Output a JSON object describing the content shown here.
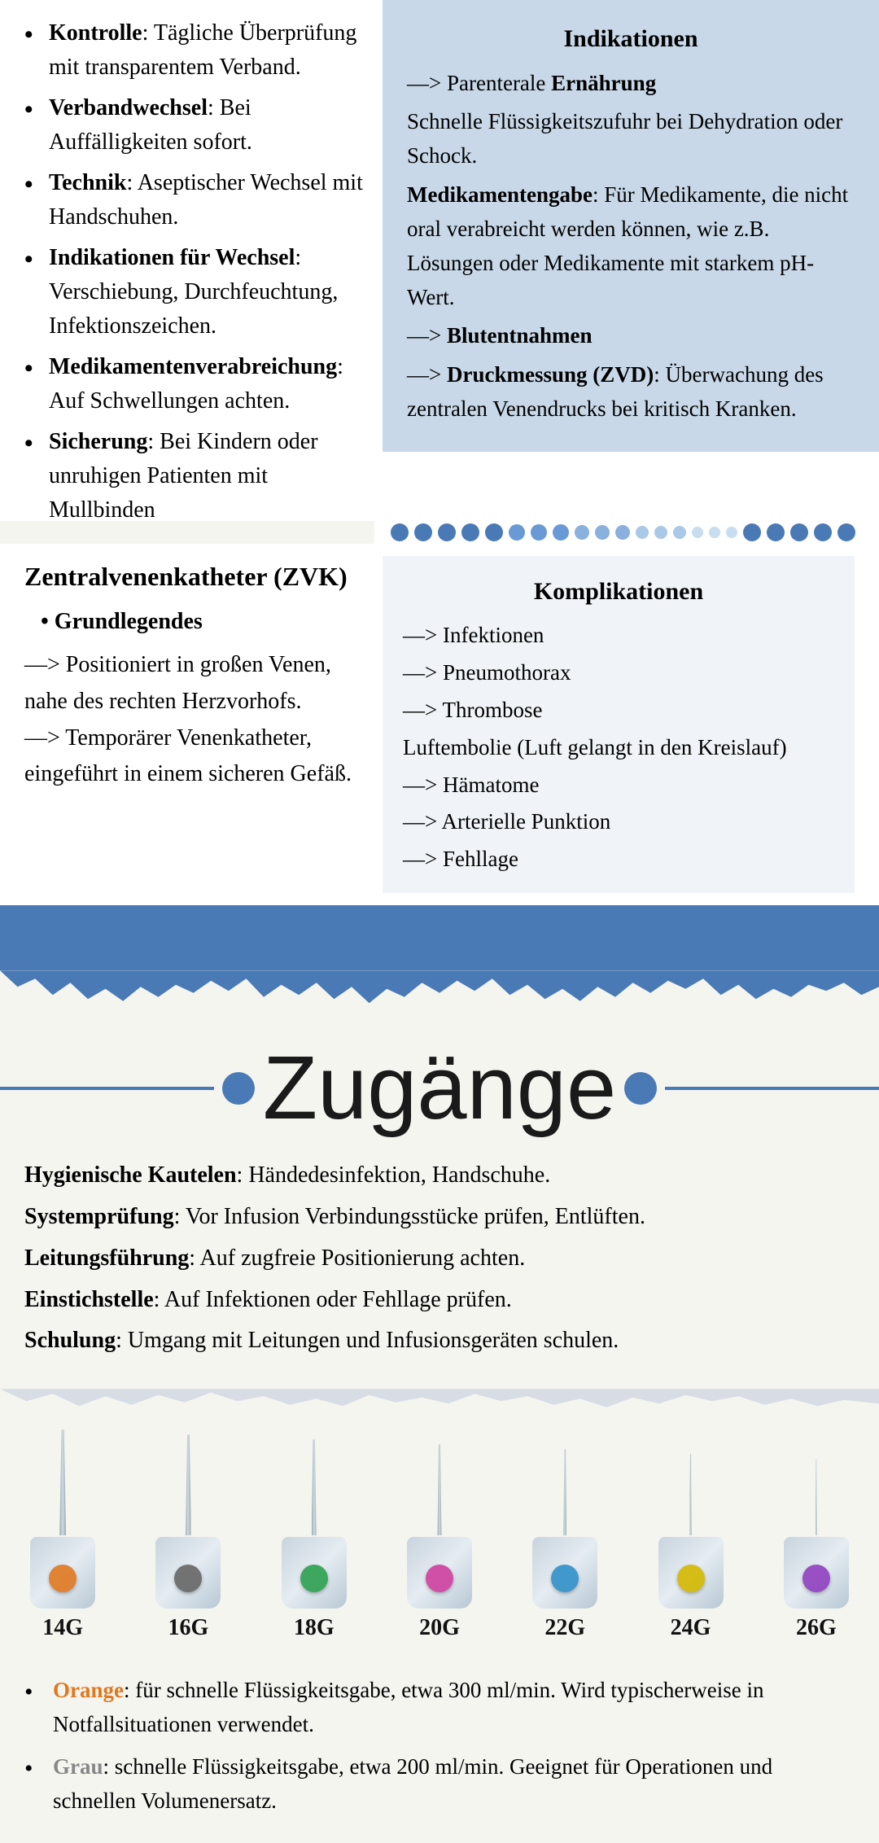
{
  "page": {
    "title": "Zugänge"
  },
  "top_left": {
    "items": [
      {
        "label": "Kontrolle",
        "text": ": Tägliche Überprüfung mit transparentem Verband."
      },
      {
        "label": "Verbandwechsel",
        "text": ": Bei Auffälligkeiten sofort."
      },
      {
        "label": "Technik",
        "text": ": Aseptischer Wechsel mit Handschuhen."
      },
      {
        "label": "Indikationen für Wechsel",
        "text": ": Verschiebung, Durchfeuchtung, Infektionszeichen."
      },
      {
        "label": "Medikamentenverabreichung",
        "text": ": Auf Schwellungen achten."
      },
      {
        "label": "Sicherung",
        "text": ": Bei Kindern oder unruhigen Patienten mit Mullbinden"
      }
    ]
  },
  "indications_box": {
    "title": "Indikationen",
    "items": [
      "—> Parenterale Ernährung",
      "Schnelle Flüssigkeitszufuhr bei Dehydration oder Schock.",
      "Medikamentengabe: Für Medikamente, die nicht oral verabreicht werden können, wie z.B. Lösungen oder Medikamente mit starkem pH-Wert.",
      "—> Blutentnahmen",
      "—> Druckmessung (ZVD): Überwachung des zentralen Venendrucks bei kritisch Kranken."
    ]
  },
  "zvk_section": {
    "title": "Zentralvenenkatheter (ZVK)",
    "sub_heading": "Grundlegendes",
    "items": [
      "—> Positioniert in großen Venen, nahe des rechten Herzvorhofs.",
      "—> Temporärer Venenkatheter, eingeführt in einem sicheren Gefäß."
    ]
  },
  "complications_box": {
    "title": "Komplikationen",
    "items": [
      "—> Infektionen",
      "—> Pneumothorax",
      "—> Thrombose",
      "Luftembolie (Luft gelangt in den Kreislauf)",
      "—> Hämatome",
      "—> Arterielle Punktion",
      "—> Fehllage"
    ]
  },
  "zugangs_title": "Zugänge",
  "bottom_content": {
    "items": [
      {
        "label": "Hygienische Kautelen",
        "text": ": Händedesinfektion, Handschuhe."
      },
      {
        "label": "Systemprüfung",
        "text": ": Vor Infusion Verbindungsstücke prüfen, Entlüften."
      },
      {
        "label": "Leitungsführung",
        "text": ": Auf zugfreie Positionierung achten."
      },
      {
        "label": "Einstichstelle",
        "text": ": Auf Infektionen oder Fehllage prüfen."
      },
      {
        "label": "Schulung",
        "text": ": Umgang mit Leitungen und Infusionsgeräten schulen."
      }
    ]
  },
  "needles": [
    {
      "gauge": "14G",
      "color": "#e07820"
    },
    {
      "gauge": "16G",
      "color": "#666666"
    },
    {
      "gauge": "18G",
      "color": "#2da050"
    },
    {
      "gauge": "20G",
      "color": "#d040a0"
    },
    {
      "gauge": "22G",
      "color": "#3090c8"
    },
    {
      "gauge": "24G",
      "color": "#d4b800"
    },
    {
      "gauge": "26G",
      "color": "#9040c0"
    }
  ],
  "legend": [
    {
      "color_label": "Orange",
      "color_class": "color-orange",
      "text": ": für schnelle Flüssigkeitsgabe, etwa 300 ml/min. Wird typischerweise in Notfallsituationen verwendet."
    },
    {
      "color_label": "Grau",
      "color_class": "color-gray",
      "text": ": schnelle Flüssigkeitsgabe, etwa 200 ml/min. Geeignet für Operationen und schnellen Volumenersatz."
    }
  ],
  "dots": {
    "colors": [
      "#4a7ab5",
      "#4a7ab5",
      "#4a7ab5",
      "#4a7ab5",
      "#4a7ab5",
      "#6a9ad5",
      "#6a9ad5",
      "#6a9ad5",
      "#8ab0dd",
      "#8ab0dd",
      "#8ab0dd",
      "#aac8e8",
      "#aac8e8",
      "#aac8e8",
      "#c8ddf0",
      "#c8ddf0",
      "#c8ddf0",
      "#4a7ab5",
      "#4a7ab5",
      "#4a7ab5",
      "#4a7ab5",
      "#4a7ab5"
    ],
    "sizes": [
      22,
      22,
      22,
      22,
      22,
      20,
      20,
      20,
      18,
      18,
      18,
      16,
      16,
      16,
      14,
      14,
      14,
      22,
      22,
      22,
      22,
      22
    ]
  }
}
